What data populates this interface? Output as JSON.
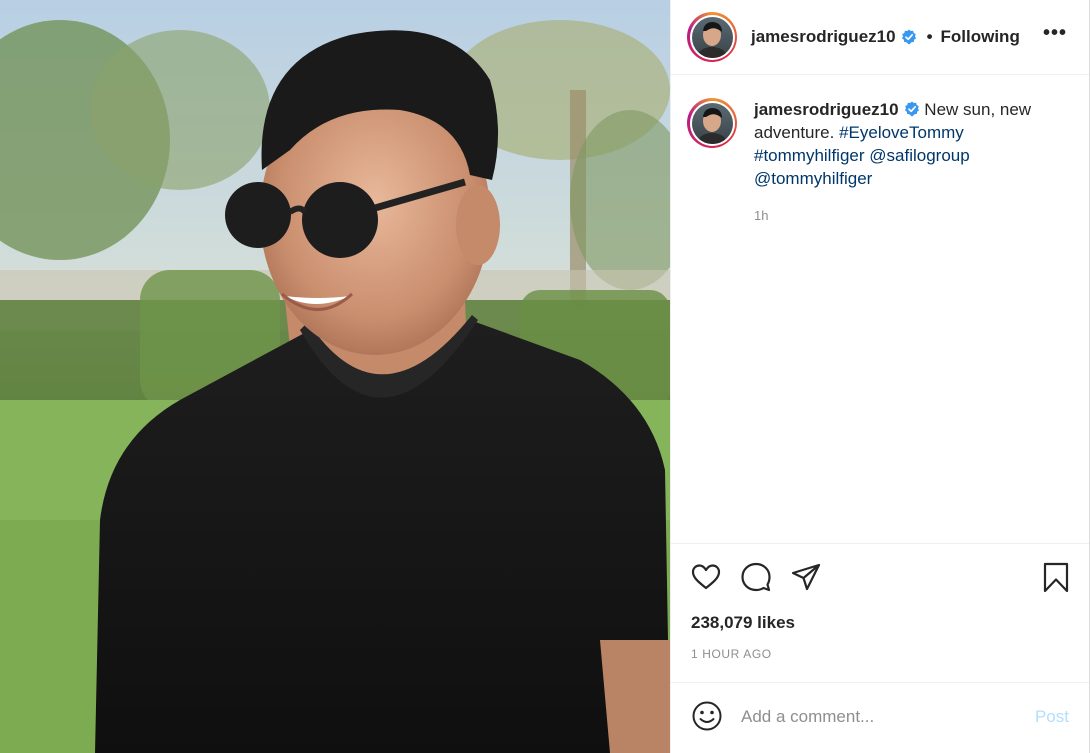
{
  "post": {
    "username": "jamesrodriguez10",
    "verified": true,
    "separator": "•",
    "follow_state": "Following",
    "more_label": "•••",
    "caption": {
      "username": "jamesrodriguez10",
      "text": "New sun, new adventure.",
      "hashtag_1": "#EyeloveTommy",
      "hashtag_2": "#tommyhilfiger",
      "mention_1": "@safilogroup",
      "mention_2": "@tommyhilfiger",
      "time": "1h"
    },
    "likes": "238,079 likes",
    "posted_ago": "1 HOUR AGO"
  },
  "comment_box": {
    "placeholder": "Add a comment...",
    "post_label": "Post"
  },
  "icons": {
    "verified": "verified-badge-icon",
    "like": "heart-icon",
    "comment": "comment-bubble-icon",
    "share": "paper-plane-icon",
    "save": "bookmark-icon",
    "emoji": "smiley-icon",
    "more": "ellipsis-icon"
  },
  "colors": {
    "verified_blue": "#3897f0",
    "link": "#00376b",
    "post_disabled": "#b2dffc",
    "muted": "#8e8e8e"
  }
}
